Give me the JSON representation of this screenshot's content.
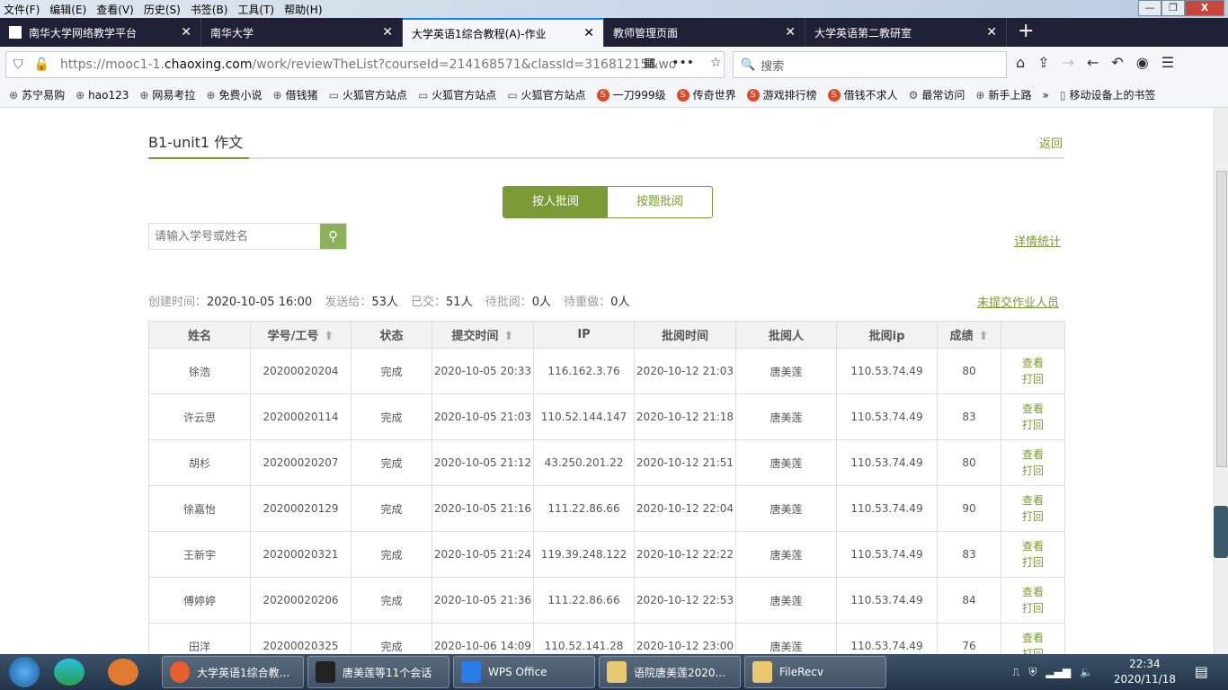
{
  "menu": [
    "文件(F)",
    "编辑(E)",
    "查看(V)",
    "历史(S)",
    "书签(B)",
    "工具(T)",
    "帮助(H)"
  ],
  "tabs": [
    {
      "label": "南华大学网络教学平台"
    },
    {
      "label": "南华大学"
    },
    {
      "label": "大学英语1综合教程(A)-作业"
    },
    {
      "label": "教师管理页面"
    },
    {
      "label": "大学英语第二教研室"
    }
  ],
  "url": {
    "prefix": "https://mooc1-1.",
    "domain": "chaoxing.com",
    "path": "/work/reviewTheList?courseId=214168571&classId=31681215&wo"
  },
  "search_placeholder": "搜索",
  "bookmarks": [
    "苏宁易购",
    "hao123",
    "网易考拉",
    "免费小说",
    "借钱猪",
    "火狐官方站点",
    "火狐官方站点",
    "火狐官方站点",
    "一刀999级",
    "传奇世界",
    "游戏排行榜",
    "借钱不求人",
    "最常访问",
    "新手上路",
    "移动设备上的书签"
  ],
  "page": {
    "title": "B1-unit1 作文",
    "back": "返回",
    "seg": [
      "按人批阅",
      "按题批阅"
    ],
    "search_placeholder": "请输入学号或姓名",
    "detail_link": "详情统计",
    "stats": {
      "created_label": "创建时间：",
      "created": "2020-10-05 16:00",
      "sent_label": "发送给：",
      "sent": "53人",
      "submitted_label": "已交：",
      "submitted": "51人",
      "pending_label": "待批阅：",
      "pending": "0人",
      "redo_label": "待重做：",
      "redo": "0人"
    },
    "unsubmitted_link": "未提交作业人员",
    "columns": [
      "姓名",
      "学号/工号",
      "状态",
      "提交时间",
      "IP",
      "批阅时间",
      "批阅人",
      "批阅ip",
      "成绩",
      ""
    ],
    "actions": [
      "查看",
      "打回"
    ],
    "rows": [
      [
        "徐浩",
        "20200020204",
        "完成",
        "2020-10-05 20:33",
        "116.162.3.76",
        "2020-10-12 21:03",
        "唐美莲",
        "110.53.74.49",
        "80"
      ],
      [
        "许云思",
        "20200020114",
        "完成",
        "2020-10-05 21:03",
        "110.52.144.147",
        "2020-10-12 21:18",
        "唐美莲",
        "110.53.74.49",
        "83"
      ],
      [
        "胡杉",
        "20200020207",
        "完成",
        "2020-10-05 21:12",
        "43.250.201.22",
        "2020-10-12 21:51",
        "唐美莲",
        "110.53.74.49",
        "80"
      ],
      [
        "徐嘉怡",
        "20200020129",
        "完成",
        "2020-10-05 21:16",
        "111.22.86.66",
        "2020-10-12 22:04",
        "唐美莲",
        "110.53.74.49",
        "90"
      ],
      [
        "王新宇",
        "20200020321",
        "完成",
        "2020-10-05 21:24",
        "119.39.248.122",
        "2020-10-12 22:22",
        "唐美莲",
        "110.53.74.49",
        "83"
      ],
      [
        "傅婷婷",
        "20200020206",
        "完成",
        "2020-10-05 21:36",
        "111.22.86.66",
        "2020-10-12 22:53",
        "唐美莲",
        "110.53.74.49",
        "84"
      ],
      [
        "田洋",
        "20200020325",
        "完成",
        "2020-10-06 14:09",
        "110.52.141.28",
        "2020-10-12 23:00",
        "唐美莲",
        "110.53.74.49",
        "76"
      ]
    ]
  },
  "taskbar": {
    "tasks": [
      "大学英语1综合教...",
      "唐美莲等11个会话",
      "WPS Office",
      "语院唐美莲2020...",
      "FileRecv"
    ],
    "time": "22:34",
    "date": "2020/11/18"
  }
}
